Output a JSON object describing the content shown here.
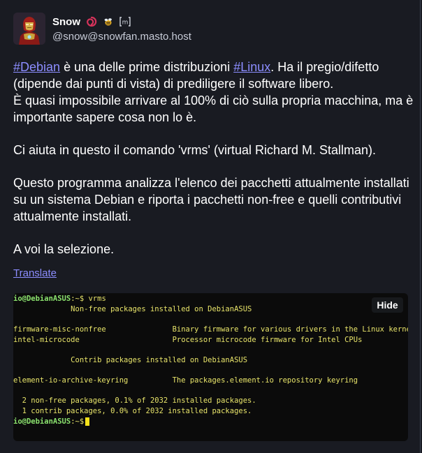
{
  "author": {
    "display_name": "Snow",
    "handle": "@snow@snowfan.masto.host",
    "badges": [
      "swirl-icon",
      "bee-icon",
      "mastodon-m-badge"
    ],
    "badge_m": "m"
  },
  "post": {
    "paragraphs": [
      {
        "hashtag1": "#Debian",
        "text1": " è una delle prime distribuzioni ",
        "hashtag2": "#Linux",
        "text2": ". Ha il pregio/difetto (dipende dai punti di vista) di prediligere il software libero.",
        "text3": "È quasi impossibile arrivare al 100% di ciò sulla propria macchina, ma è importante sapere cosa non lo è."
      },
      "Ci aiuta in questo il comando 'vrms' (virtual Richard M. Stallman).",
      "Questo programma analizza l'elenco dei pacchetti attualmente installati su un sistema Debian e riporta i pacchetti non-free e quelli contributivi attualmente installati.",
      "A voi la selezione."
    ],
    "translate_label": "Translate"
  },
  "media": {
    "hide_label": "Hide",
    "terminal": {
      "prompt_user": "io@DebianASUS",
      "prompt_sep": ":~$",
      "command": " vrms",
      "line_nonfree_header": "             Non-free packages installed on DebianASUS",
      "row1": "firmware-misc-nonfree               Binary firmware for various drivers in the Linux kernel",
      "row2": "intel-microcode                     Processor microcode firmware for Intel CPUs",
      "line_contrib_header": "             Contrib packages installed on DebianASUS",
      "row3": "element-io-archive-keyring          The packages.element.io repository keyring",
      "summary1": "  2 non-free packages, 0.1% of 2032 installed packages.",
      "summary2": "  1 contrib packages, 0.0% of 2032 installed packages."
    }
  },
  "colors": {
    "background": "#191b22",
    "link": "#8c8dff",
    "terminal_bg": "#0b0b0b",
    "terminal_text": "#e8e46a",
    "prompt_green": "#8be26e"
  }
}
